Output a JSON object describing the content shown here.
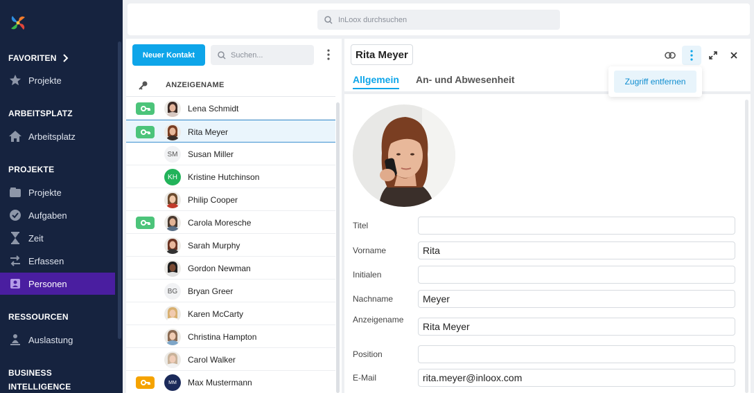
{
  "sidebar": {
    "sections": {
      "favoriten": "FAVORITEN",
      "arbeitsplatz": "ARBEITSPLATZ",
      "projekte": "PROJEKTE",
      "ressourcen": "RESSOURCEN",
      "bi_1": "BUSINESS",
      "bi_2": "INTELLIGENCE"
    },
    "items": [
      {
        "label": "Projekte",
        "icon": "star-icon"
      },
      {
        "label": "Arbeitsplatz",
        "icon": "home-icon"
      },
      {
        "label": "Projekte",
        "icon": "folder-icon"
      },
      {
        "label": "Aufgaben",
        "icon": "check-circle-icon"
      },
      {
        "label": "Zeit",
        "icon": "hourglass-icon"
      },
      {
        "label": "Erfassen",
        "icon": "transfer-icon"
      },
      {
        "label": "Personen",
        "icon": "contact-card-icon",
        "active": true
      },
      {
        "label": "Auslastung",
        "icon": "person-load-icon"
      }
    ]
  },
  "topbar": {
    "search_placeholder": "InLoox durchsuchen"
  },
  "list": {
    "new_button": "Neuer Kontakt",
    "search_placeholder": "Suchen...",
    "column_header": "ANZEIGENAME",
    "rows": [
      {
        "name": "Lena Schmidt",
        "badge": "green",
        "initials": ""
      },
      {
        "name": "Rita Meyer",
        "badge": "green",
        "initials": "",
        "selected": true
      },
      {
        "name": "Susan Miller",
        "badge": "",
        "initials": "SM"
      },
      {
        "name": "Kristine Hutchinson",
        "badge": "",
        "initials": "KH"
      },
      {
        "name": "Philip Cooper",
        "badge": "",
        "initials": ""
      },
      {
        "name": "Carola Moresche",
        "badge": "green",
        "initials": ""
      },
      {
        "name": "Sarah Murphy",
        "badge": "",
        "initials": ""
      },
      {
        "name": "Gordon Newman",
        "badge": "",
        "initials": ""
      },
      {
        "name": "Bryan Greer",
        "badge": "",
        "initials": "BG"
      },
      {
        "name": "Karen McCarty",
        "badge": "",
        "initials": ""
      },
      {
        "name": "Christina Hampton",
        "badge": "",
        "initials": ""
      },
      {
        "name": "Carol Walker",
        "badge": "",
        "initials": ""
      },
      {
        "name": "Max Mustermann",
        "badge": "orange",
        "initials": "MM"
      }
    ]
  },
  "detail": {
    "title": "Rita Meyer",
    "tabs": [
      "Allgemein",
      "An- und Abwesenheit"
    ],
    "fields": [
      {
        "label": "Titel",
        "value": ""
      },
      {
        "label": "Vorname",
        "value": "Rita"
      },
      {
        "label": "Initialen",
        "value": ""
      },
      {
        "label": "Nachname",
        "value": "Meyer"
      },
      {
        "label": "Anzeigename",
        "value": "Rita Meyer"
      },
      {
        "label": "Position",
        "value": ""
      },
      {
        "label": "E-Mail",
        "value": "rita.meyer@inloox.com"
      }
    ],
    "menu_item": "Zugriff entfernen"
  },
  "colors": {
    "accent": "#0ea5e9",
    "sidebar_bg": "#16233f",
    "active_nav": "#4a1ea0",
    "badge_green": "#4cc47a",
    "badge_orange": "#f5a300"
  }
}
